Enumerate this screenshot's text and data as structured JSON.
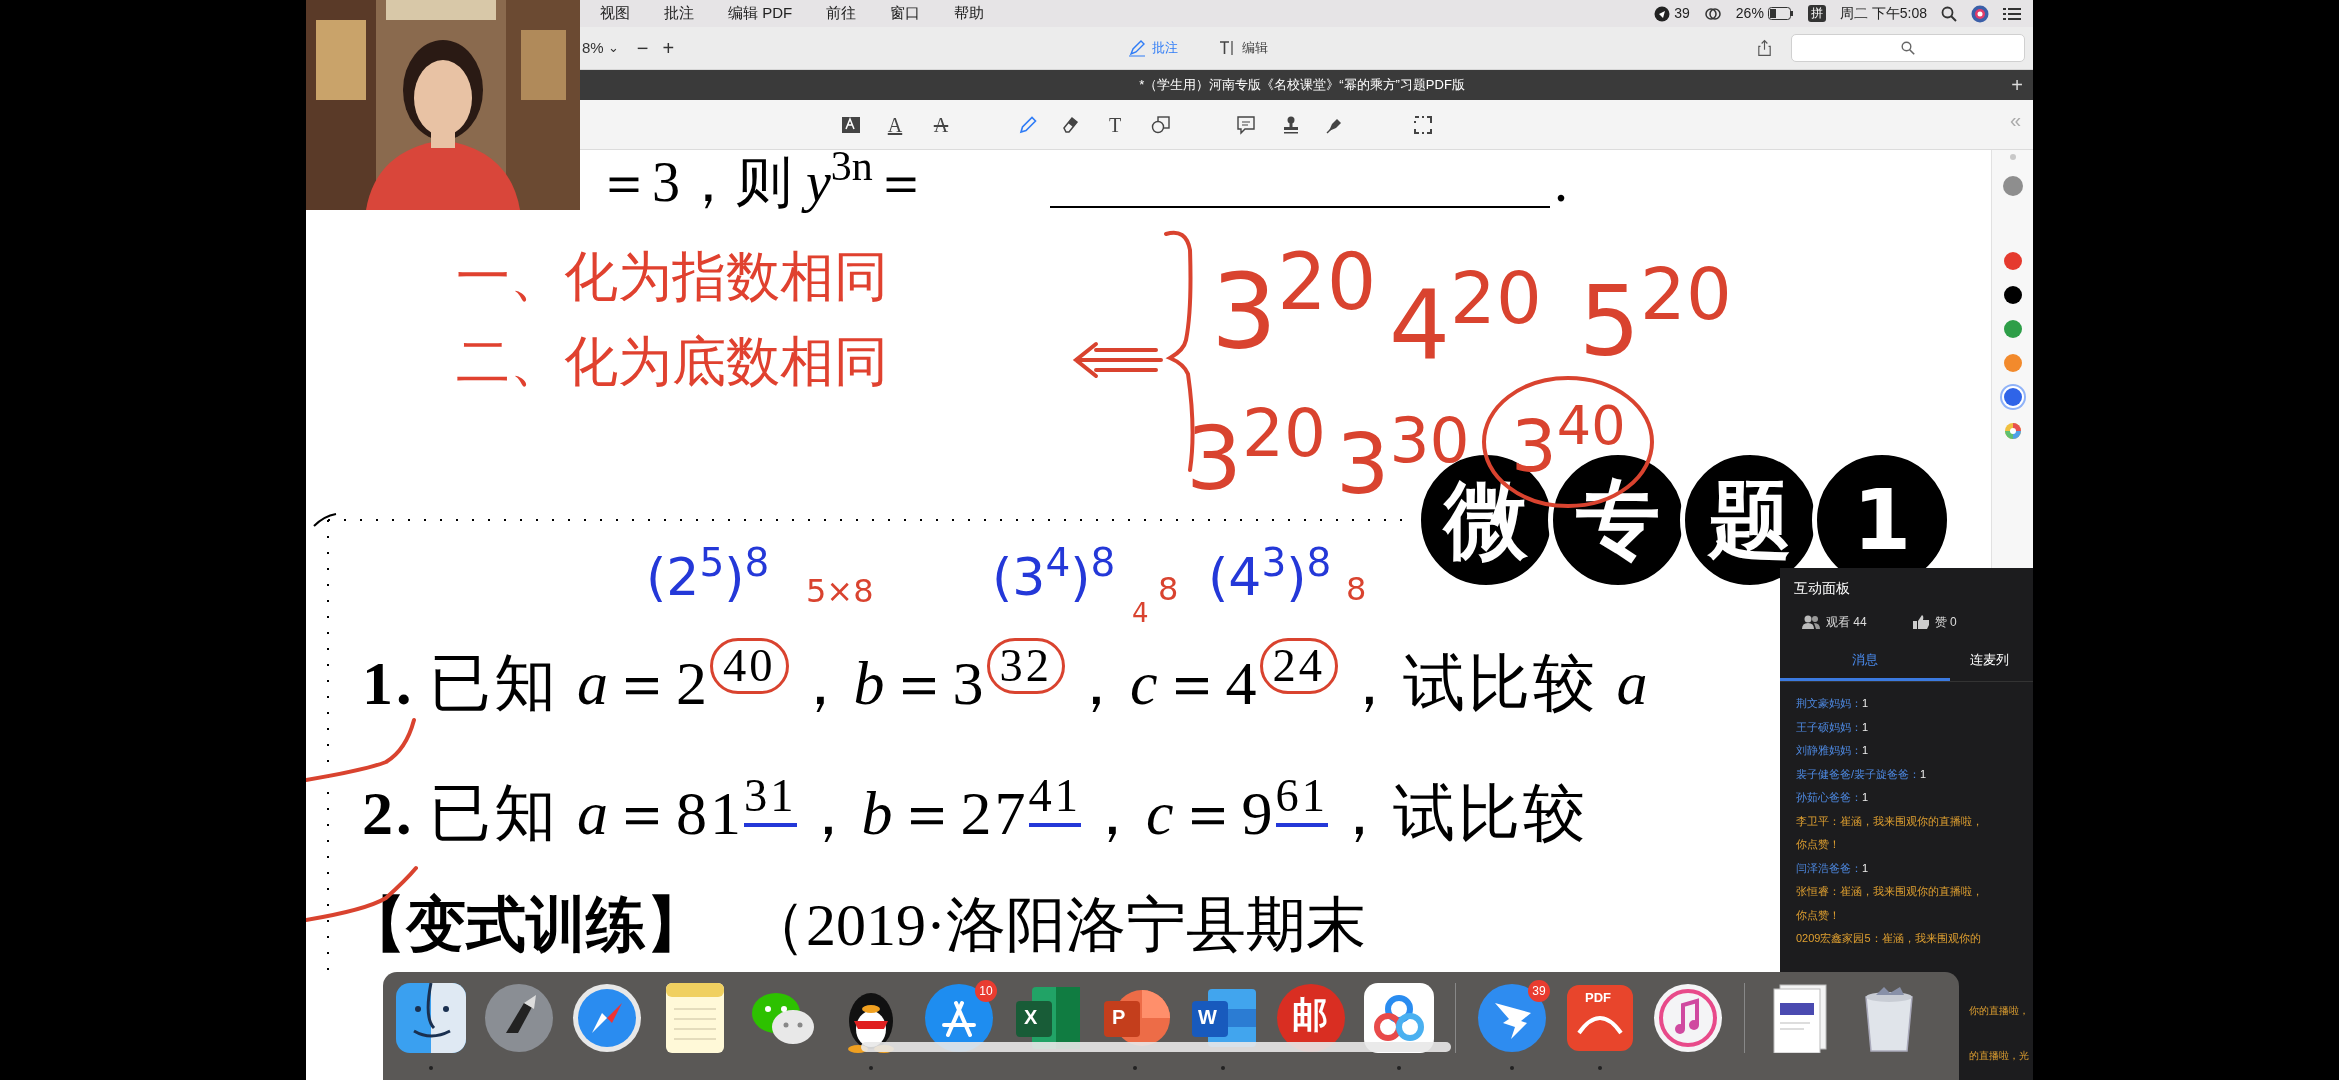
{
  "menu_bar": {
    "items": [
      "视图",
      "批注",
      "编辑 PDF",
      "前往",
      "窗口",
      "帮助"
    ],
    "notifications": "39",
    "battery": "26%",
    "input_method": "拼",
    "clock": "周二 下午5:08"
  },
  "toolbar": {
    "zoom": "8%",
    "zoom_caret": "⌄",
    "zoom_out": "−",
    "zoom_in": "+",
    "modes": [
      {
        "kind": "annotate",
        "label": "批注",
        "selected": true
      },
      {
        "kind": "edit",
        "label": "编辑",
        "selected": false
      }
    ]
  },
  "document_tab": {
    "title": "*（学生用）河南专版《名校课堂》“幂的乘方”习题PDF版",
    "add": "+"
  },
  "annotation_tools": [
    {
      "kind": "textbox",
      "selected": false
    },
    {
      "kind": "underline",
      "glyph": "A",
      "selected": false
    },
    {
      "kind": "strike",
      "glyph": "A",
      "selected": false
    },
    {
      "kind": "pencil",
      "selected": true
    },
    {
      "kind": "eraser",
      "selected": false
    },
    {
      "kind": "text",
      "glyph": "T",
      "selected": false
    },
    {
      "kind": "shapes",
      "selected": false
    },
    {
      "kind": "note",
      "selected": false
    },
    {
      "kind": "stamp",
      "selected": false
    },
    {
      "kind": "pen",
      "selected": false
    },
    {
      "kind": "select",
      "selected": false
    }
  ],
  "sidebar_collapse": "«",
  "palette": [
    {
      "kind": "size",
      "color": "#c8c8c8",
      "selected": false
    },
    {
      "kind": "size",
      "color": "#8e8e8e",
      "selected": false
    },
    {
      "kind": "color",
      "color": "#e53a2e",
      "selected": false
    },
    {
      "kind": "color",
      "color": "#000000",
      "selected": false
    },
    {
      "kind": "color",
      "color": "#2e9e48",
      "selected": false
    },
    {
      "kind": "color",
      "color": "#f28a2c",
      "selected": false
    },
    {
      "kind": "color",
      "color": "#2f64e8",
      "selected": true
    },
    {
      "kind": "wheel",
      "selected": false
    }
  ],
  "document": {
    "top_line": "＝3，则 *y*$^{3n}$＝",
    "blank_end": ".",
    "methods": [
      "一、化为指数相同",
      "二、化为底数相同"
    ],
    "badge": [
      "微",
      "专",
      "题",
      "1"
    ],
    "problems": [
      {
        "number": "1.",
        "text": "已知 *a*＝2$^{40}$，*b*＝3$^{32}$，*c*＝4$^{24}$，试比较 *a*"
      },
      {
        "number": "2.",
        "text": "已知 *a*＝81$^{31}$，*b*＝27$^{41}$，*c*＝9$^{61}$，试比较"
      }
    ],
    "variant": {
      "label": "【变式训练】",
      "source": "（2019·洛阳洛宁县期末"
    },
    "ink": [
      {
        "text": "3$^{20}$",
        "color": "#d9432f"
      },
      {
        "text": "4$^{20}$",
        "color": "#d9432f"
      },
      {
        "text": "5$^{20}$",
        "color": "#d9432f"
      },
      {
        "text": "3$^{20}$",
        "color": "#d9432f"
      },
      {
        "text": "3$^{30}$",
        "color": "#d9432f"
      },
      {
        "text": "3$^{40}$",
        "color": "#d9432f"
      },
      {
        "text": "(2$^{5}$)$^{8}$",
        "color": "#2438d8"
      },
      {
        "text": "5×8",
        "color": "#d9432f"
      },
      {
        "text": "(3$^{4}$)$^{8}$",
        "color": "#2438d8"
      },
      {
        "text": "4",
        "color": "#d9432f"
      },
      {
        "text": "8",
        "color": "#d9432f"
      },
      {
        "text": "(4$^{3}$)$^{8}$",
        "color": "#2438d8"
      },
      {
        "text": "8",
        "color": "#d9432f"
      }
    ]
  },
  "chat_panel": {
    "title": "互动面板",
    "viewers": "观看 44",
    "likes": "赞 0",
    "tabs": [
      {
        "label": "消息",
        "selected": true
      },
      {
        "label": "连麦列",
        "selected": false
      }
    ],
    "messages": [
      {
        "kind": "reply",
        "name": "荆文豪妈妈：",
        "text": "1"
      },
      {
        "kind": "reply",
        "name": "王子硕妈妈：",
        "text": "1"
      },
      {
        "kind": "reply",
        "name": "刘静雅妈妈：",
        "text": "1"
      },
      {
        "kind": "reply",
        "name": "裴子健爸爸/裴子旋爸爸：",
        "text": "1"
      },
      {
        "kind": "reply",
        "name": "孙茹心爸爸：",
        "text": "1"
      },
      {
        "kind": "greeting",
        "lines": [
          "李卫平：崔涵，我来围观你的直播啦，",
          "你点赞！"
        ]
      },
      {
        "kind": "reply",
        "name": "闫泽浩爸爸：",
        "text": "1"
      },
      {
        "kind": "greeting",
        "lines": [
          "张恒睿：崔涵，我来围观你的直播啦，",
          "你点赞！"
        ]
      },
      {
        "kind": "greeting",
        "lines": [
          "0209宏鑫家园5：崔涵，我来围观你的"
        ]
      }
    ],
    "covered_tail": [
      "你的直播啦，",
      "的直播啦，光"
    ]
  },
  "dock": [
    {
      "kind": "finder",
      "running": true
    },
    {
      "kind": "launchpad",
      "running": false
    },
    {
      "kind": "safari",
      "running": false
    },
    {
      "kind": "notes",
      "running": false
    },
    {
      "kind": "wechat",
      "running": false
    },
    {
      "kind": "qq",
      "running": true
    },
    {
      "kind": "appstore",
      "badge": "10",
      "running": false
    },
    {
      "kind": "excel",
      "label": "X",
      "running": false
    },
    {
      "kind": "powerpoint",
      "label": "P",
      "running": true
    },
    {
      "kind": "word",
      "label": "W",
      "running": true
    },
    {
      "kind": "mail",
      "label": "邮",
      "running": false
    },
    {
      "kind": "cloud",
      "running": true
    },
    {
      "kind": "separator"
    },
    {
      "kind": "dingtalk",
      "badge": "39",
      "running": true
    },
    {
      "kind": "pdf",
      "label": "PDF",
      "running": true
    },
    {
      "kind": "music",
      "running": false
    },
    {
      "kind": "separator"
    },
    {
      "kind": "document",
      "running": false
    },
    {
      "kind": "trash",
      "running": false
    }
  ]
}
